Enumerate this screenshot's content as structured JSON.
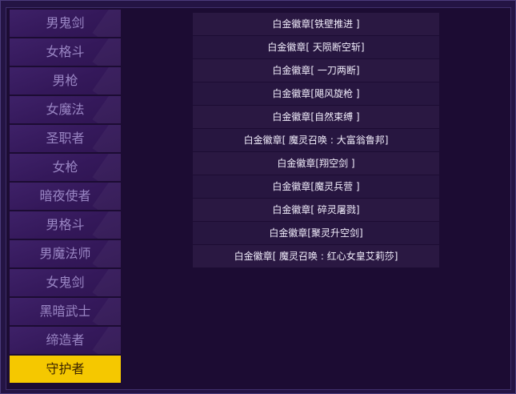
{
  "sidebar": {
    "items": [
      {
        "label": "男鬼剑"
      },
      {
        "label": "女格斗"
      },
      {
        "label": "男枪"
      },
      {
        "label": "女魔法"
      },
      {
        "label": "圣职者"
      },
      {
        "label": "女枪"
      },
      {
        "label": "暗夜使者"
      },
      {
        "label": "男格斗"
      },
      {
        "label": "男魔法师"
      },
      {
        "label": "女鬼剑"
      },
      {
        "label": "黑暗武士"
      },
      {
        "label": "缔造者"
      },
      {
        "label": "守护者"
      }
    ],
    "active_index": 12
  },
  "badges": [
    {
      "label": "白金徽章[铁壁推进 ]"
    },
    {
      "label": "白金徽章[ 天陨断空斩]"
    },
    {
      "label": "白金徽章[ 一刀两断]"
    },
    {
      "label": "白金徽章[飓风旋枪 ]"
    },
    {
      "label": "白金徽章[自然束缚 ]"
    },
    {
      "label": "白金徽章[ 魔灵召唤 : 大富翁鲁邦]"
    },
    {
      "label": "白金徽章[翔空剑 ]"
    },
    {
      "label": "白金徽章[魔灵兵营 ]"
    },
    {
      "label": "白金徽章[ 碎灵屠戮]"
    },
    {
      "label": "白金徽章[聚灵升空剑]"
    },
    {
      "label": "白金徽章[ 魔灵召唤 : 红心女皇艾莉莎]"
    }
  ],
  "colors": {
    "active_tab": "#f5c800",
    "background": "#1c0c33"
  }
}
